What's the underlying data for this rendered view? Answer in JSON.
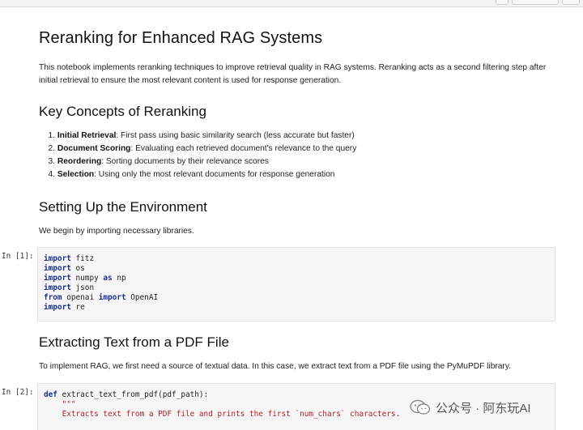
{
  "notebook": {
    "title": "Reranking for Enhanced RAG Systems",
    "intro": "This notebook implements reranking techniques to improve retrieval quality in RAG systems. Reranking acts as a second filtering step after initial retrieval to ensure the most relevant content is used for response generation.",
    "concepts_heading": "Key Concepts of Reranking",
    "concepts": [
      {
        "num": "1.",
        "term": "Initial Retrieval",
        "desc": ": First pass using basic similarity search (less accurate but faster)"
      },
      {
        "num": "2.",
        "term": "Document Scoring",
        "desc": ": Evaluating each retrieved document's relevance to the query"
      },
      {
        "num": "3.",
        "term": "Reordering",
        "desc": ": Sorting documents by their relevance scores"
      },
      {
        "num": "4.",
        "term": "Selection",
        "desc": ": Using only the most relevant documents for response generation"
      }
    ],
    "setup_heading": "Setting Up the Environment",
    "setup_text": "We begin by importing necessary libraries.",
    "pdf_heading": "Extracting Text from a PDF File",
    "pdf_text": "To implement RAG, we first need a source of textual data. In this case, we extract text from a PDF file using the PyMuPDF library."
  },
  "cells": [
    {
      "prompt": "In [1]:",
      "lines": [
        [
          {
            "t": "import",
            "k": "kw"
          },
          {
            "t": " fitz"
          }
        ],
        [
          {
            "t": "import",
            "k": "kw"
          },
          {
            "t": " os"
          }
        ],
        [
          {
            "t": "import",
            "k": "kw"
          },
          {
            "t": " numpy "
          },
          {
            "t": "as",
            "k": "kw"
          },
          {
            "t": " np"
          }
        ],
        [
          {
            "t": "import",
            "k": "kw"
          },
          {
            "t": " json"
          }
        ],
        [
          {
            "t": "from",
            "k": "kw"
          },
          {
            "t": " openai "
          },
          {
            "t": "import",
            "k": "kw"
          },
          {
            "t": " OpenAI"
          }
        ],
        [
          {
            "t": "import",
            "k": "kw"
          },
          {
            "t": " re"
          }
        ]
      ]
    },
    {
      "prompt": "In [2]:",
      "lines": [
        [
          {
            "t": "def",
            "k": "kw"
          },
          {
            "t": " extract_text_from_pdf(pdf_path):"
          }
        ],
        [
          {
            "t": "    \"\"\"",
            "k": "str"
          }
        ],
        [
          {
            "t": "    Extracts text from a PDF file and prints the first `num_chars` characters.",
            "k": "str"
          }
        ]
      ]
    }
  ],
  "watermark": {
    "text": "公众号 · 阿东玩AI",
    "icon": "wechat-icon",
    "color": "#555555"
  },
  "colors": {
    "keyword": "#1a2f8f",
    "string": "#b22222",
    "cell_bg": "#f6f6f6"
  }
}
